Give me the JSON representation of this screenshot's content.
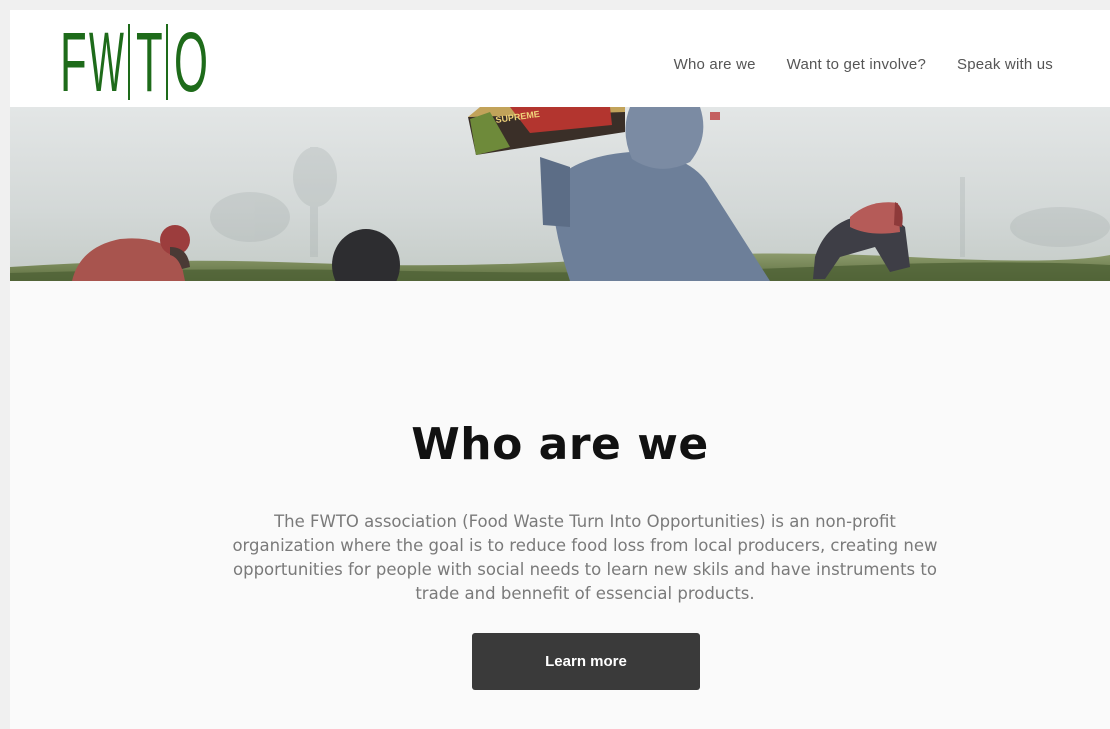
{
  "header": {
    "logo": {
      "letters": [
        "F",
        "W",
        "T",
        "O"
      ],
      "alt": "FWTO"
    },
    "nav": [
      {
        "label": "Who are we"
      },
      {
        "label": "Want to get involve?"
      },
      {
        "label": "Speak with us"
      }
    ]
  },
  "hero": {
    "box_label": "SUPREME"
  },
  "main": {
    "title": "Who are we",
    "description": "The FWTO association (Food Waste Turn Into Opportunities) is an non-profit organization where the goal is to reduce food loss from local producers, creating new opportunities for people with social needs to learn new skils and have instruments to trade and bennefit of essencial products.",
    "button_label": "Learn more"
  },
  "colors": {
    "brand_green": "#1e6b1a",
    "button_bg": "#3a3a3a",
    "nav_text": "#555555",
    "body_text": "#7a7a7a"
  }
}
